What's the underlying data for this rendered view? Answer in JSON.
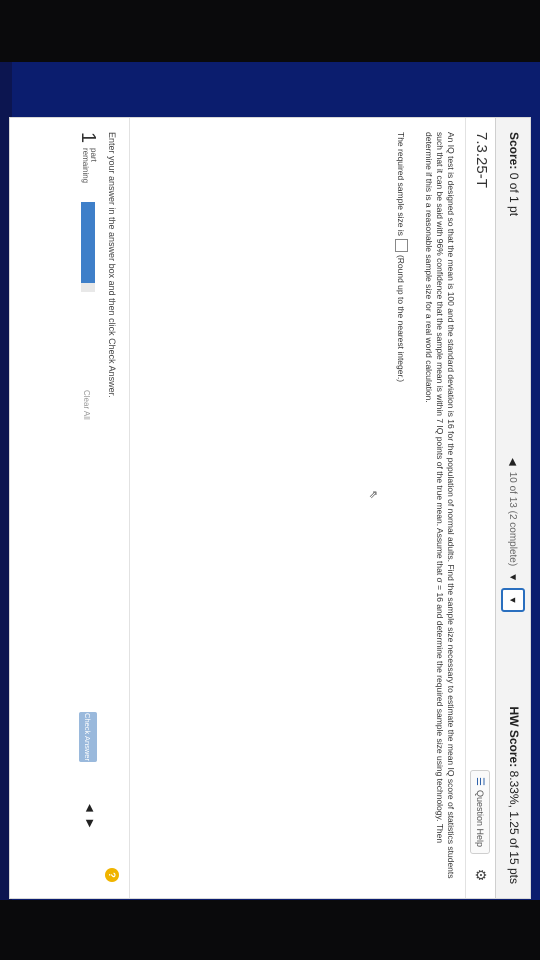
{
  "score": {
    "label": "Score:",
    "value": "0 of 1 pt"
  },
  "navigation": {
    "progress": "10 of 13 (2 complete)",
    "box": "▼"
  },
  "hw_score": {
    "label": "HW Score:",
    "value": "8.33%, 1.25 of 15 pts"
  },
  "question": {
    "id": "7.3.25-T",
    "help_label": "Question Help",
    "text": "An IQ test is designed so that the mean is 100 and the standard deviation is 16 for the population of normal adults. Find the sample size necessary to estimate the mean IQ score of statistics students such that it can be said with 96% confidence that the sample mean is within 7 IQ points of the true mean. Assume that σ = 16 and determine the required sample size using technology. Then determine if this is a reasonable sample size for a real world calculation.",
    "answer_prefix": "The required sample size is",
    "answer_suffix": "(Round up to the nearest integer.)"
  },
  "footer": {
    "instruction": "Enter your answer in the answer box and then click Check Answer.",
    "parts_count": "1",
    "parts_label_line1": "part",
    "parts_label_line2": "remaining",
    "progress_fraction": 0.9,
    "clear_all": "Clear All",
    "check_answer": "Check Answer",
    "help_symbol": "?"
  },
  "colors": {
    "accent": "#3e7fc9",
    "button": "#9ab9dc",
    "background": "#0b1d6e"
  }
}
